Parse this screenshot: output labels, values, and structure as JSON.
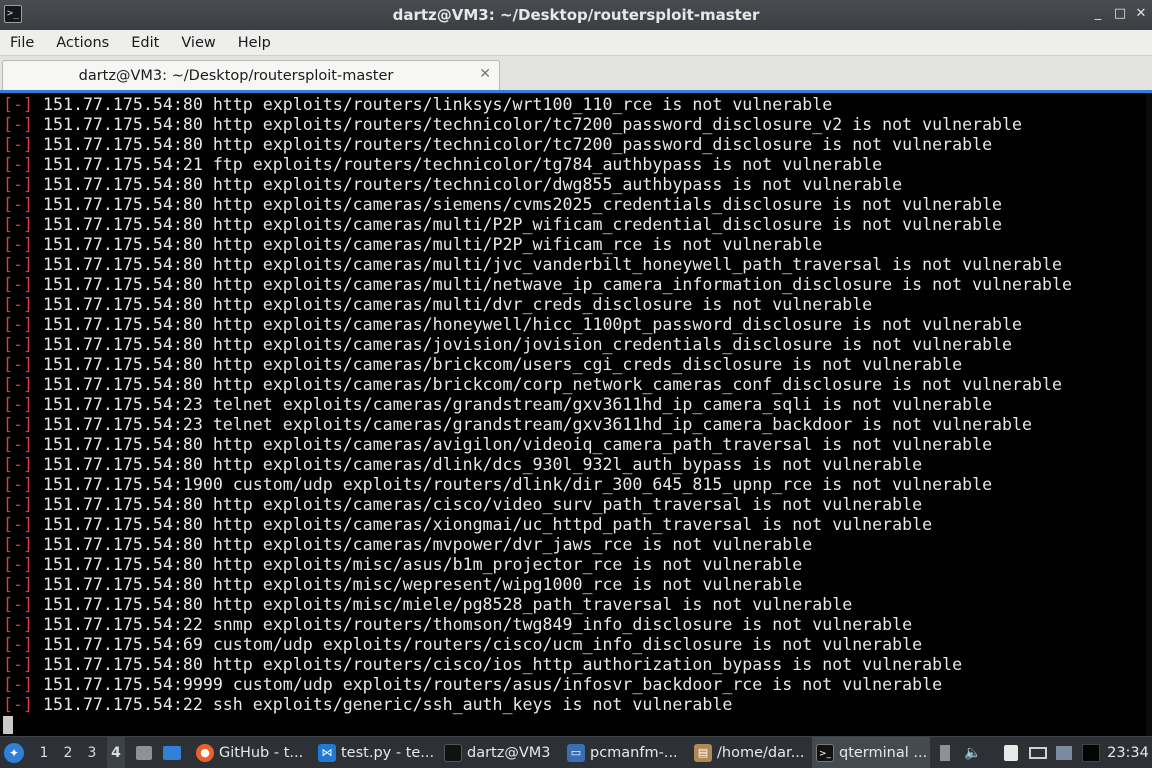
{
  "window": {
    "title": "dartz@VM3: ~/Desktop/routersploit-master",
    "app_icon": "terminal-icon",
    "controls": {
      "minimize": "_",
      "maximize": "□",
      "close": "✕"
    }
  },
  "menubar": {
    "items": [
      "File",
      "Actions",
      "Edit",
      "View",
      "Help"
    ]
  },
  "tabs": [
    {
      "label": "dartz@VM3: ~/Desktop/routersploit-master",
      "close": "✕"
    }
  ],
  "terminal": {
    "prefix": "[-]",
    "lines": [
      "151.77.175.54:80 http exploits/routers/linksys/wrt100_110_rce is not vulnerable",
      "151.77.175.54:80 http exploits/routers/technicolor/tc7200_password_disclosure_v2 is not vulnerable",
      "151.77.175.54:80 http exploits/routers/technicolor/tc7200_password_disclosure is not vulnerable",
      "151.77.175.54:21 ftp exploits/routers/technicolor/tg784_authbypass is not vulnerable",
      "151.77.175.54:80 http exploits/routers/technicolor/dwg855_authbypass is not vulnerable",
      "151.77.175.54:80 http exploits/cameras/siemens/cvms2025_credentials_disclosure is not vulnerable",
      "151.77.175.54:80 http exploits/cameras/multi/P2P_wificam_credential_disclosure is not vulnerable",
      "151.77.175.54:80 http exploits/cameras/multi/P2P_wificam_rce is not vulnerable",
      "151.77.175.54:80 http exploits/cameras/multi/jvc_vanderbilt_honeywell_path_traversal is not vulnerable",
      "151.77.175.54:80 http exploits/cameras/multi/netwave_ip_camera_information_disclosure is not vulnerable",
      "151.77.175.54:80 http exploits/cameras/multi/dvr_creds_disclosure is not vulnerable",
      "151.77.175.54:80 http exploits/cameras/honeywell/hicc_1100pt_password_disclosure is not vulnerable",
      "151.77.175.54:80 http exploits/cameras/jovision/jovision_credentials_disclosure is not vulnerable",
      "151.77.175.54:80 http exploits/cameras/brickcom/users_cgi_creds_disclosure is not vulnerable",
      "151.77.175.54:80 http exploits/cameras/brickcom/corp_network_cameras_conf_disclosure is not vulnerable",
      "151.77.175.54:23 telnet exploits/cameras/grandstream/gxv3611hd_ip_camera_sqli is not vulnerable",
      "151.77.175.54:23 telnet exploits/cameras/grandstream/gxv3611hd_ip_camera_backdoor is not vulnerable",
      "151.77.175.54:80 http exploits/cameras/avigilon/videoiq_camera_path_traversal is not vulnerable",
      "151.77.175.54:80 http exploits/cameras/dlink/dcs_930l_932l_auth_bypass is not vulnerable",
      "151.77.175.54:1900 custom/udp exploits/routers/dlink/dir_300_645_815_upnp_rce is not vulnerable",
      "151.77.175.54:80 http exploits/cameras/cisco/video_surv_path_traversal is not vulnerable",
      "151.77.175.54:80 http exploits/cameras/xiongmai/uc_httpd_path_traversal is not vulnerable",
      "151.77.175.54:80 http exploits/cameras/mvpower/dvr_jaws_rce is not vulnerable",
      "151.77.175.54:80 http exploits/misc/asus/b1m_projector_rce is not vulnerable",
      "151.77.175.54:80 http exploits/misc/wepresent/wipg1000_rce is not vulnerable",
      "151.77.175.54:80 http exploits/misc/miele/pg8528_path_traversal is not vulnerable",
      "151.77.175.54:22 snmp exploits/routers/thomson/twg849_info_disclosure is not vulnerable",
      "151.77.175.54:69 custom/udp exploits/routers/cisco/ucm_info_disclosure is not vulnerable",
      "151.77.175.54:80 http exploits/routers/cisco/ios_http_authorization_bypass is not vulnerable",
      "151.77.175.54:9999 custom/udp exploits/routers/asus/infosvr_backdoor_rce is not vulnerable",
      "151.77.175.54:22 ssh exploits/generic/ssh_auth_keys is not vulnerable"
    ]
  },
  "taskbar": {
    "desktops": [
      "1",
      "2",
      "3",
      "4"
    ],
    "active_desktop": "4",
    "tasks": [
      {
        "label": "GitHub - t...",
        "icon": "firefox-icon"
      },
      {
        "label": "test.py - te...",
        "icon": "vscode-icon"
      },
      {
        "label": "dartz@VM3",
        "icon": "terminal-icon"
      },
      {
        "label": "pcmanfm-...",
        "icon": "folder-icon"
      },
      {
        "label": "/home/dar...",
        "icon": "archive-icon"
      },
      {
        "label": "qterminal ...",
        "icon": "terminal-icon"
      }
    ],
    "clock": "23:34"
  },
  "colors": {
    "prefix_red": "#e03c3c",
    "terminal_bg": "#000000",
    "accent_blue": "#2f80d6"
  }
}
